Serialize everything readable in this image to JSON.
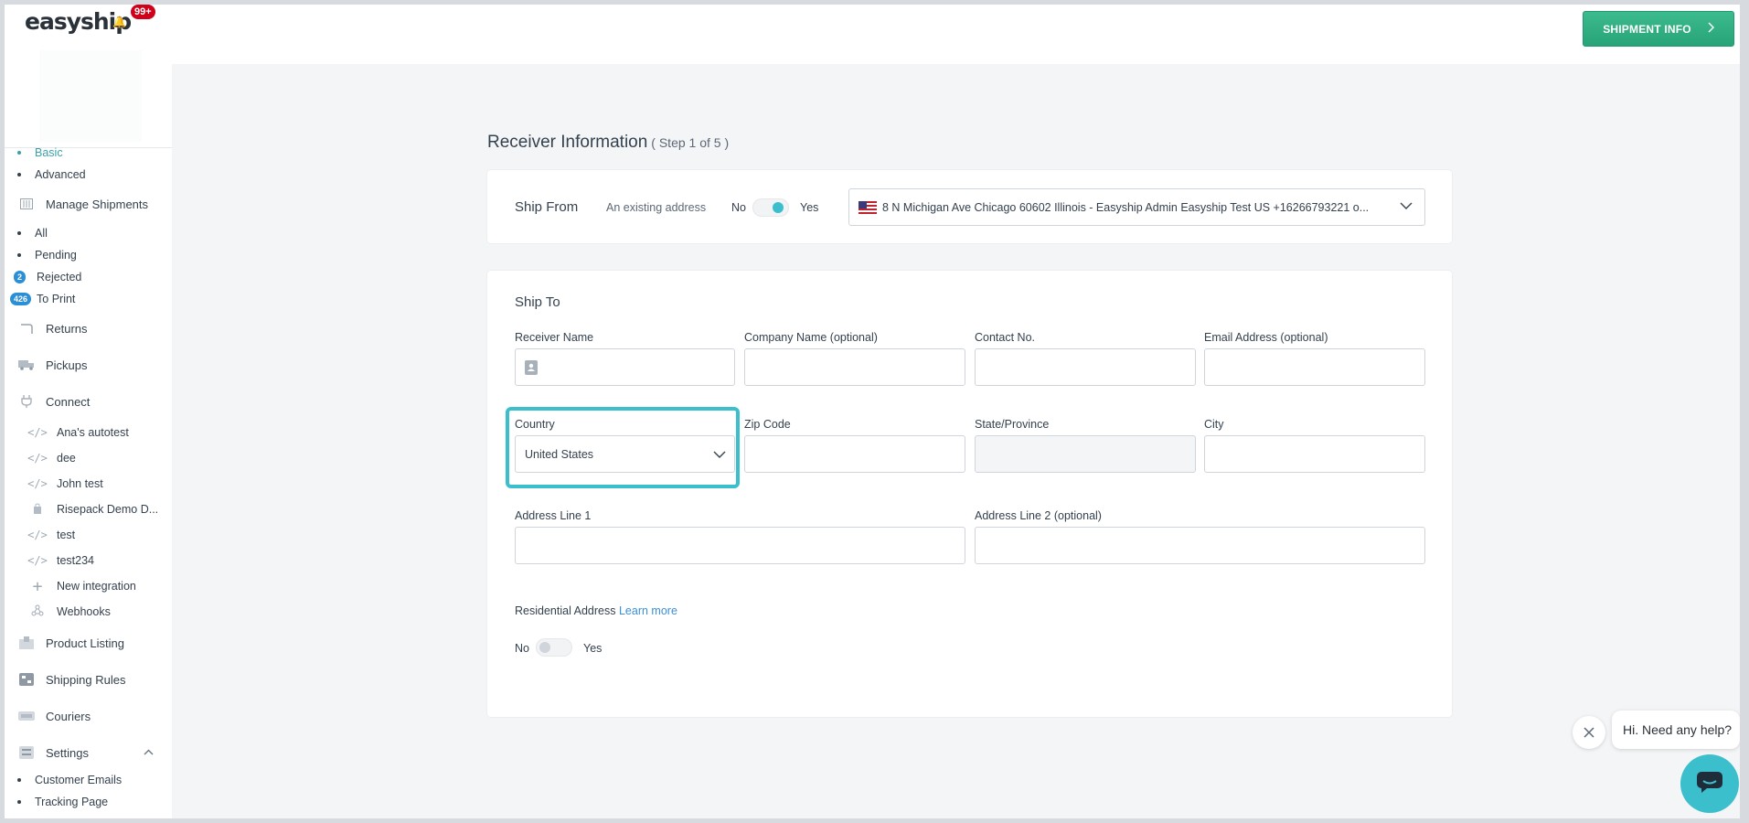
{
  "brand": {
    "logo_text": "easyship",
    "notification_count": "99+"
  },
  "sidebar": {
    "create_items": [
      {
        "label": "Basic",
        "active": true
      },
      {
        "label": "Advanced",
        "active": false
      }
    ],
    "manage_shipments": "Manage Shipments",
    "shipment_items": [
      {
        "label": "All"
      },
      {
        "label": "Pending"
      }
    ],
    "rejected": {
      "count": "2",
      "label": "Rejected"
    },
    "to_print": {
      "count": "426",
      "label": "To Print"
    },
    "returns": "Returns",
    "pickups": "Pickups",
    "connect": "Connect",
    "integrations": [
      {
        "label": "Ana's autotest",
        "icon": "code-icon"
      },
      {
        "label": "dee",
        "icon": "code-icon"
      },
      {
        "label": "John test",
        "icon": "code-icon"
      },
      {
        "label": "Risepack Demo D...",
        "icon": "bag-icon"
      },
      {
        "label": "test",
        "icon": "code-icon"
      },
      {
        "label": "test234",
        "icon": "code-icon"
      },
      {
        "label": "New integration",
        "icon": "plus-icon"
      },
      {
        "label": "Webhooks",
        "icon": "webhook-icon"
      }
    ],
    "product_listing": "Product Listing",
    "shipping_rules": "Shipping Rules",
    "couriers": "Couriers",
    "settings": "Settings",
    "settings_items": [
      {
        "label": "Customer Emails"
      },
      {
        "label": "Tracking Page"
      }
    ]
  },
  "topbar": {
    "shipment_info_label": "SHIPMENT INFO"
  },
  "page": {
    "title": "Receiver Information",
    "step": "( Step 1 of 5 )"
  },
  "ship_from": {
    "title": "Ship From",
    "existing_label": "An existing address",
    "no_label": "No",
    "yes_label": "Yes",
    "existing_on": true,
    "address": "8 N Michigan Ave Chicago 60602 Illinois - Easyship Admin Easyship Test US +16266793221 o..."
  },
  "ship_to": {
    "title": "Ship To",
    "fields": {
      "receiver_name": "Receiver Name",
      "company_name": "Company Name (optional)",
      "contact_no": "Contact No.",
      "email": "Email Address (optional)",
      "country": "Country",
      "country_value": "United States",
      "zip": "Zip Code",
      "state": "State/Province",
      "city": "City",
      "address1": "Address Line 1",
      "address2": "Address Line 2 (optional)"
    },
    "residential_label": "Residential Address",
    "learn_more": "Learn more",
    "residential_no": "No",
    "residential_yes": "Yes",
    "residential_on": false
  },
  "chat": {
    "help_text": "Hi. Need any help?"
  },
  "colors": {
    "accent": "#3bbfcc",
    "primary_button": "#2eae81",
    "badge_red": "#d0021b",
    "badge_blue": "#2b8fd6"
  }
}
